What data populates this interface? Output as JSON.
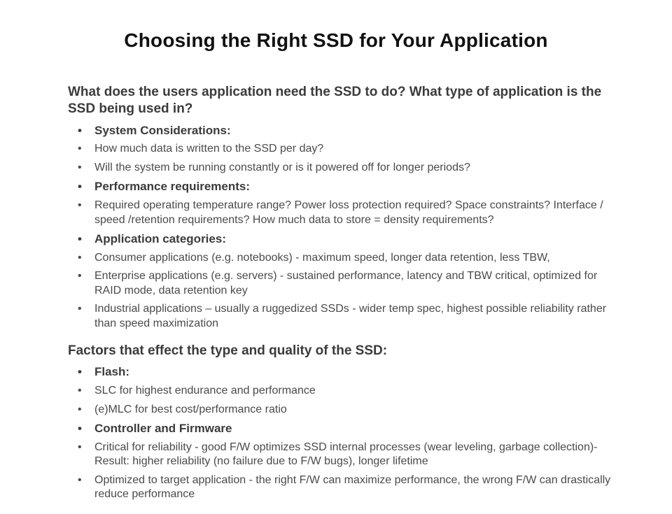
{
  "title": "Choosing the Right SSD for Your Application",
  "section1": {
    "heading": "What does the users application need the SSD to do? What type of application is the SSD being used in?",
    "items": [
      {
        "text": "System Considerations:",
        "bold": true
      },
      {
        "text": "How much data is written to the SSD per day?",
        "bold": false
      },
      {
        "text": "Will the system be running constantly or is it powered off for longer periods?",
        "bold": false
      },
      {
        "text": "Performance requirements:",
        "bold": true
      },
      {
        "text": "Required operating temperature range? Power loss protection required? Space constraints? Interface / speed /retention requirements? How much data to store = density requirements?",
        "bold": false
      },
      {
        "text": "Application categories:",
        "bold": true
      },
      {
        "text": "Consumer applications (e.g. notebooks) - maximum speed, longer data retention, less TBW,",
        "bold": false
      },
      {
        "text": "Enterprise applications (e.g. servers) - sustained performance, latency and TBW critical, optimized for RAID mode, data retention key",
        "bold": false
      },
      {
        "text": "Industrial applications – usually a ruggedized SSDs - wider temp spec, highest possible reliability rather than speed maximization",
        "bold": false
      }
    ]
  },
  "section2": {
    "heading": "Factors that effect the type and quality of the SSD:",
    "items": [
      {
        "text": "Flash:",
        "bold": true
      },
      {
        "text": "SLC for highest endurance and performance",
        "bold": false
      },
      {
        "text": "(e)MLC for best cost/performance ratio",
        "bold": false
      },
      {
        "text": "Controller and Firmware",
        "bold": true
      },
      {
        "text": "Critical for reliability - good F/W optimizes SSD internal processes (wear leveling, garbage collection)- Result: higher reliability (no failure due to F/W bugs), longer lifetime",
        "bold": false
      },
      {
        "text": "Optimized to target application - the right F/W can maximize performance, the wrong F/W can drastically reduce performance",
        "bold": false
      }
    ]
  }
}
